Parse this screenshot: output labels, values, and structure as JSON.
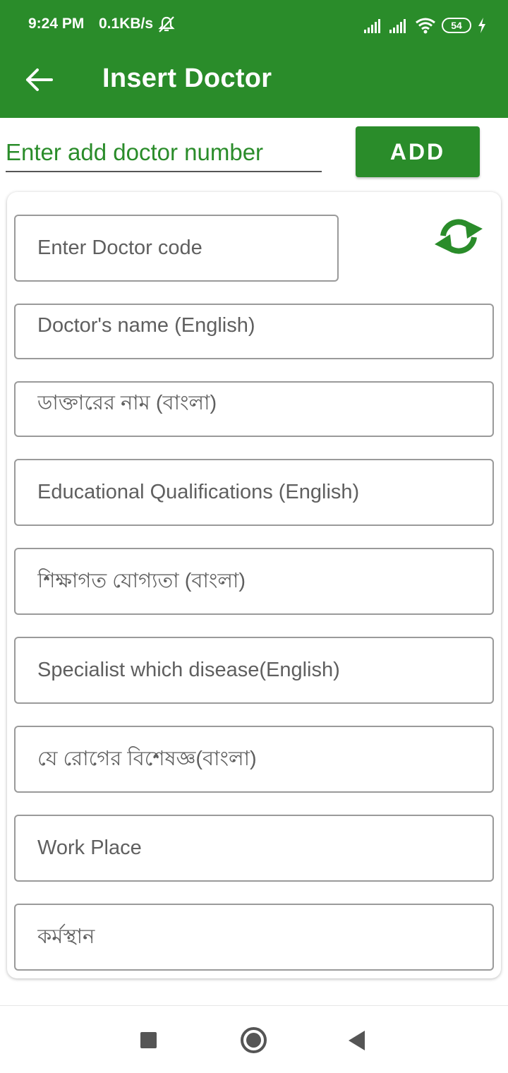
{
  "status_bar": {
    "time": "9:24 PM",
    "net_speed": "0.1KB/s",
    "battery": "54",
    "icons": [
      "mute-icon",
      "signal-icon",
      "signal-icon",
      "wifi-icon",
      "battery-icon",
      "charging-icon"
    ]
  },
  "app_bar": {
    "title": "Insert Doctor",
    "back_icon": "arrow-left-icon",
    "color": "#2a8c2a"
  },
  "add_number": {
    "placeholder": "Enter add doctor number",
    "value": "",
    "button_label": "ADD"
  },
  "form": {
    "refresh_icon": "refresh-sync-icon",
    "fields": {
      "doctor_code": {
        "placeholder": "Enter Doctor code",
        "value": ""
      },
      "name_en": {
        "placeholder": "Doctor's name (English)",
        "value": ""
      },
      "name_bn": {
        "placeholder": "ডাক্তারের নাম (বাংলা)",
        "value": ""
      },
      "edu_en": {
        "placeholder": "Educational Qualifications (English)",
        "value": ""
      },
      "edu_bn": {
        "placeholder": "শিক্ষাগত যোগ্যতা (বাংলা)",
        "value": ""
      },
      "specialist_en": {
        "placeholder": "Specialist which disease(English)",
        "value": ""
      },
      "specialist_bn": {
        "placeholder": "যে রোগের বিশেষজ্ঞ(বাংলা)",
        "value": ""
      },
      "workplace_en": {
        "placeholder": "Work Place",
        "value": ""
      },
      "workplace_bn": {
        "placeholder": "কর্মস্থান",
        "value": ""
      }
    }
  },
  "nav_bar": {
    "icons": [
      "recent-apps-icon",
      "home-icon",
      "back-icon"
    ]
  }
}
